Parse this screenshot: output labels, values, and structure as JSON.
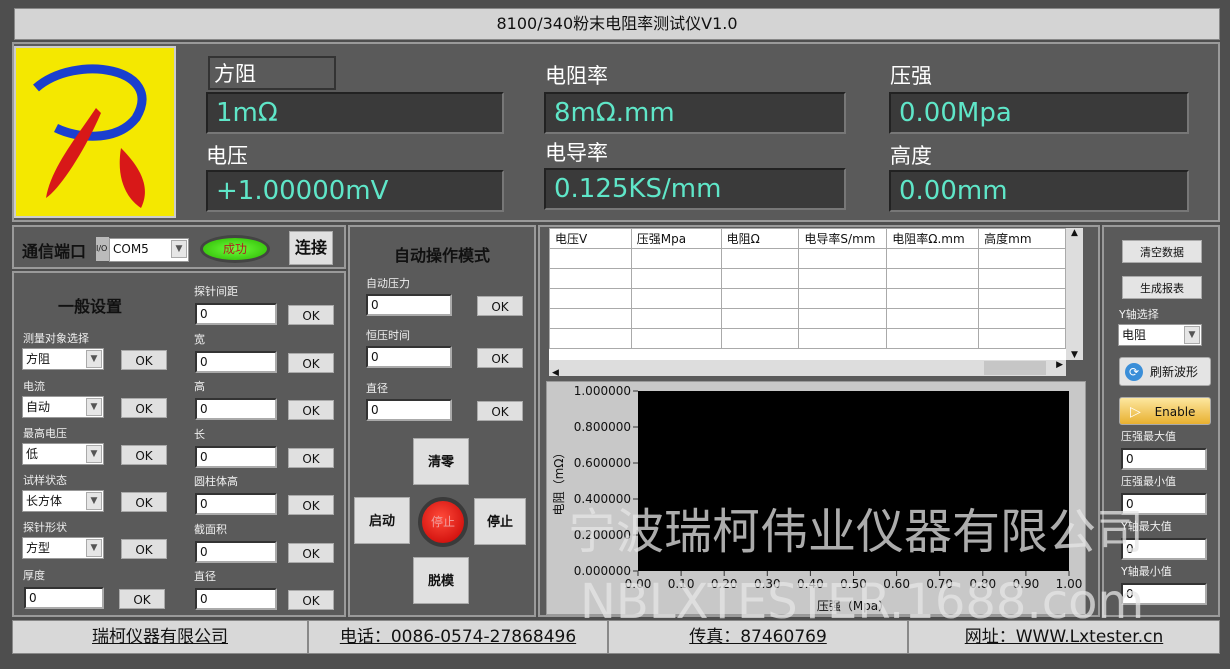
{
  "title": "8100/340粉末电阻率测试仪V1.0",
  "readouts": [
    {
      "label": "方阻",
      "value": "1mΩ"
    },
    {
      "label": "电阻率",
      "value": "8mΩ.mm"
    },
    {
      "label": "压强",
      "value": "0.00Mpa"
    },
    {
      "label": "电压",
      "value": "+1.00000mV"
    },
    {
      "label": "电导率",
      "value": "0.125KS/mm"
    },
    {
      "label": "高度",
      "value": "0.00mm"
    }
  ],
  "comm": {
    "label": "通信端口",
    "io": "I/O",
    "port": "COM5",
    "status": "成功",
    "connect": "连接",
    "status_color": "#3ad400"
  },
  "general": {
    "title": "一般设置",
    "selects": [
      {
        "label": "测量对象选择",
        "value": "方阻"
      },
      {
        "label": "电流",
        "value": "自动"
      },
      {
        "label": "最高电压",
        "value": "低"
      },
      {
        "label": "试样状态",
        "value": "长方体"
      },
      {
        "label": "探针形状",
        "value": "方型"
      }
    ],
    "thickness": {
      "label": "厚度",
      "value": "0"
    },
    "fields": [
      {
        "label": "探针间距",
        "value": "0"
      },
      {
        "label": "宽",
        "value": "0"
      },
      {
        "label": "高",
        "value": "0"
      },
      {
        "label": "长",
        "value": "0"
      },
      {
        "label": "圆柱体高",
        "value": "0"
      },
      {
        "label": "截面积",
        "value": "0"
      },
      {
        "label": "直径",
        "value": "0"
      }
    ],
    "ok": "OK"
  },
  "auto": {
    "title": "自动操作模式",
    "fields": [
      {
        "label": "自动压力",
        "value": "0"
      },
      {
        "label": "恒压时间",
        "value": "0"
      },
      {
        "label": "直径",
        "value": "0"
      }
    ],
    "clear": "清零",
    "start": "启动",
    "stop_led": "停止",
    "stop": "停止",
    "demold": "脱模"
  },
  "table": {
    "headers": [
      "电压V",
      "压强Mpa",
      "电阻Ω",
      "电导率S/mm",
      "电阻率Ω.mm",
      "高度mm"
    ]
  },
  "chart_data": {
    "type": "line",
    "xlabel": "压强（Mpa）",
    "ylabel": "电阻（mΩ）",
    "xlim": [
      0,
      1
    ],
    "ylim": [
      0,
      1
    ],
    "xticks": [
      "0.00",
      "0.10",
      "0.20",
      "0.30",
      "0.40",
      "0.50",
      "0.60",
      "0.70",
      "0.80",
      "0.90",
      "1.00"
    ],
    "yticks": [
      "0.000000",
      "0.200000",
      "0.400000",
      "0.600000",
      "0.800000",
      "1.000000"
    ],
    "series": [],
    "background": "#000000"
  },
  "right": {
    "clear_data": "清空数据",
    "report": "生成报表",
    "y_select_label": "Y轴选择",
    "y_select": "电阻",
    "refresh": "刷新波形",
    "enable": "Enable",
    "fields": [
      {
        "label": "压强最大值",
        "value": "0"
      },
      {
        "label": "压强最小值",
        "value": "0"
      },
      {
        "label": "Y轴最大值",
        "value": "0"
      },
      {
        "label": "Y轴最小值",
        "value": "0"
      }
    ]
  },
  "footer": [
    "瑞柯仪器有限公司",
    "电话：0086-0574-27868496",
    "传真：87460769",
    "网址：WWW.Lxtester.cn"
  ],
  "watermark": [
    "宁波瑞柯伟业仪器有限公司",
    "NBLXTESTER.1688.com"
  ]
}
